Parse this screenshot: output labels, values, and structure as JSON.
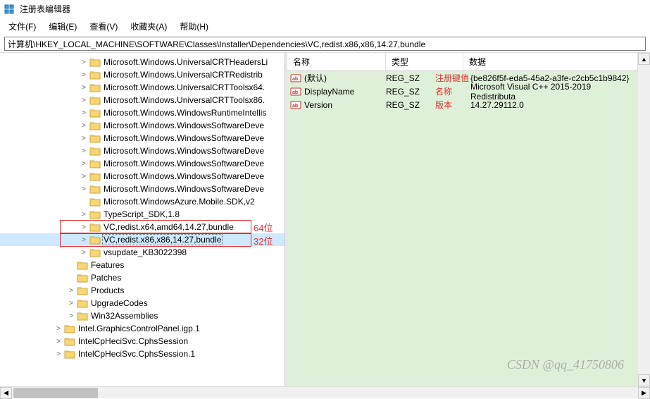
{
  "window": {
    "title": "注册表编辑器"
  },
  "menu": {
    "file": "文件(F)",
    "edit": "编辑(E)",
    "view": "查看(V)",
    "favorites": "收藏夹(A)",
    "help": "帮助(H)"
  },
  "address": "计算机\\HKEY_LOCAL_MACHINE\\SOFTWARE\\Classes\\Installer\\Dependencies\\VC,redist.x86,x86,14.27,bundle",
  "tree": {
    "indent_base": 95,
    "items": [
      {
        "label": "Microsoft.Windows.UniversalCRTHeadersLi",
        "level": 1,
        "exp": ">"
      },
      {
        "label": "Microsoft.Windows.UniversalCRTRedistrib",
        "level": 1,
        "exp": ">"
      },
      {
        "label": "Microsoft.Windows.UniversalCRTToolsx64.",
        "level": 1,
        "exp": ">"
      },
      {
        "label": "Microsoft.Windows.UniversalCRTToolsx86.",
        "level": 1,
        "exp": ">"
      },
      {
        "label": "Microsoft.Windows.WindowsRuntimeIntellis",
        "level": 1,
        "exp": ">"
      },
      {
        "label": "Microsoft.Windows.WindowsSoftwareDeve",
        "level": 1,
        "exp": ">"
      },
      {
        "label": "Microsoft.Windows.WindowsSoftwareDeve",
        "level": 1,
        "exp": ">"
      },
      {
        "label": "Microsoft.Windows.WindowsSoftwareDeve",
        "level": 1,
        "exp": ">"
      },
      {
        "label": "Microsoft.Windows.WindowsSoftwareDeve",
        "level": 1,
        "exp": ">"
      },
      {
        "label": "Microsoft.Windows.WindowsSoftwareDeve",
        "level": 1,
        "exp": ">"
      },
      {
        "label": "Microsoft.Windows.WindowsSoftwareDeve",
        "level": 1,
        "exp": ">"
      },
      {
        "label": "Microsoft.WindowsAzure.Mobile.SDK,v2",
        "level": 1,
        "exp": ""
      },
      {
        "label": "TypeScript_SDK,1.8",
        "level": 1,
        "exp": ">"
      },
      {
        "label": "VC,redist.x64,amd64,14.27,bundle",
        "level": 1,
        "exp": ">",
        "boxed": true
      },
      {
        "label": "VC,redist.x86,x86,14.27,bundle",
        "level": 1,
        "exp": ">",
        "selected": true,
        "boxed": true
      },
      {
        "label": "vsupdate_KB3022398",
        "level": 1,
        "exp": ">"
      },
      {
        "label": "Features",
        "level": 0,
        "exp": ""
      },
      {
        "label": "Patches",
        "level": 0,
        "exp": ""
      },
      {
        "label": "Products",
        "level": 0,
        "exp": ">"
      },
      {
        "label": "UpgradeCodes",
        "level": 0,
        "exp": ">"
      },
      {
        "label": "Win32Assemblies",
        "level": 0,
        "exp": ">"
      },
      {
        "label": "Intel.GraphicsControlPanel.igp.1",
        "level": -1,
        "exp": ">"
      },
      {
        "label": "IntelCpHeciSvc.CphsSession",
        "level": -1,
        "exp": ">"
      },
      {
        "label": "IntelCpHeciSvc.CphsSession.1",
        "level": -1,
        "exp": ">"
      }
    ]
  },
  "values": {
    "headers": {
      "name": "名称",
      "type": "类型",
      "data": "数据"
    },
    "rows": [
      {
        "name": "(默认)",
        "type": "REG_SZ",
        "data": "{be826f5f-eda5-45a2-a3fe-c2cb5c1b9842}",
        "annot": "注册键值"
      },
      {
        "name": "DisplayName",
        "type": "REG_SZ",
        "data": "Microsoft Visual C++ 2015-2019 Redistributa",
        "annot": "名称"
      },
      {
        "name": "Version",
        "type": "REG_SZ",
        "data": "14.27.29112.0",
        "annot": "版本"
      }
    ]
  },
  "annotations": {
    "x64_label": "64位",
    "x86_label": "32位"
  },
  "watermark": "CSDN @qq_41750806"
}
